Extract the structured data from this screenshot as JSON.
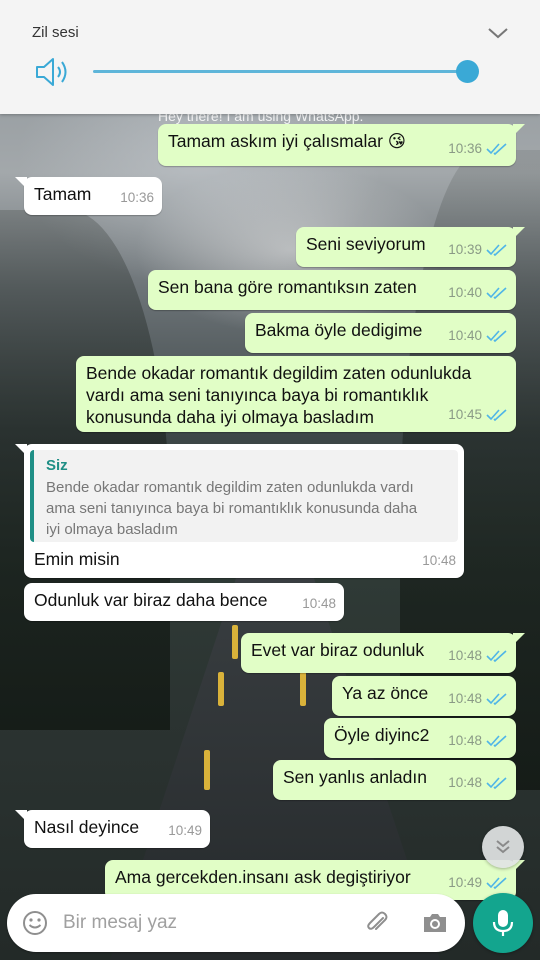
{
  "volume": {
    "title": "Zil sesi",
    "level_percent": 100,
    "accent": "#3aa9d6",
    "icons": [
      "speaker-icon",
      "chevron-down-icon"
    ]
  },
  "chat": {
    "status_line": "Hey there! I am using WhatsApp.",
    "messages": [
      {
        "dir": "out",
        "text": "Tamam askım iyi çalısmalar 😘",
        "time": "10:36",
        "read": true
      },
      {
        "dir": "in",
        "text": "Tamam",
        "time": "10:36"
      },
      {
        "dir": "out",
        "text": "Seni seviyorum",
        "time": "10:39",
        "read": true
      },
      {
        "dir": "out",
        "text": "Sen bana göre romantıksın zaten",
        "time": "10:40",
        "read": true
      },
      {
        "dir": "out",
        "text": "Bakma öyle dedigime",
        "time": "10:40",
        "read": true
      },
      {
        "dir": "out",
        "text_lines": [
          "Bende okadar romantık degildim zaten odunlukda",
          "vardı ama seni tanıyınca baya bi romantıklık",
          "konusunda daha iyi olmaya basladım"
        ],
        "time": "10:45",
        "read": true
      },
      {
        "dir": "in",
        "quote": {
          "author": "Siz",
          "text_lines": [
            "Bende okadar romantık degildim zaten odunlukda vardı",
            "ama seni tanıyınca baya bi romantıklık konusunda daha",
            "iyi olmaya basladım"
          ]
        },
        "text": "Emin misin",
        "time": "10:48"
      },
      {
        "dir": "in",
        "text": "Odunluk var biraz daha bence",
        "time": "10:48"
      },
      {
        "dir": "out",
        "text": "Evet var biraz odunluk",
        "time": "10:48",
        "read": true
      },
      {
        "dir": "out",
        "text": "Ya az önce",
        "time": "10:48",
        "read": true
      },
      {
        "dir": "out",
        "text": "Öyle diyinc2",
        "time": "10:48",
        "read": true
      },
      {
        "dir": "out",
        "text": "Sen yanlıs anladın",
        "time": "10:48",
        "read": true
      },
      {
        "dir": "in",
        "text": "Nasıl deyince",
        "time": "10:49"
      },
      {
        "dir": "out",
        "text": "Ama gercekden.insanı ask degiştiriyor",
        "time": "10:49",
        "read": true
      }
    ]
  },
  "composer": {
    "placeholder": "Bir mesaj yaz",
    "icons": [
      "emoji-icon",
      "attach-icon",
      "camera-icon",
      "mic-icon"
    ],
    "accent": "#13a58e"
  }
}
